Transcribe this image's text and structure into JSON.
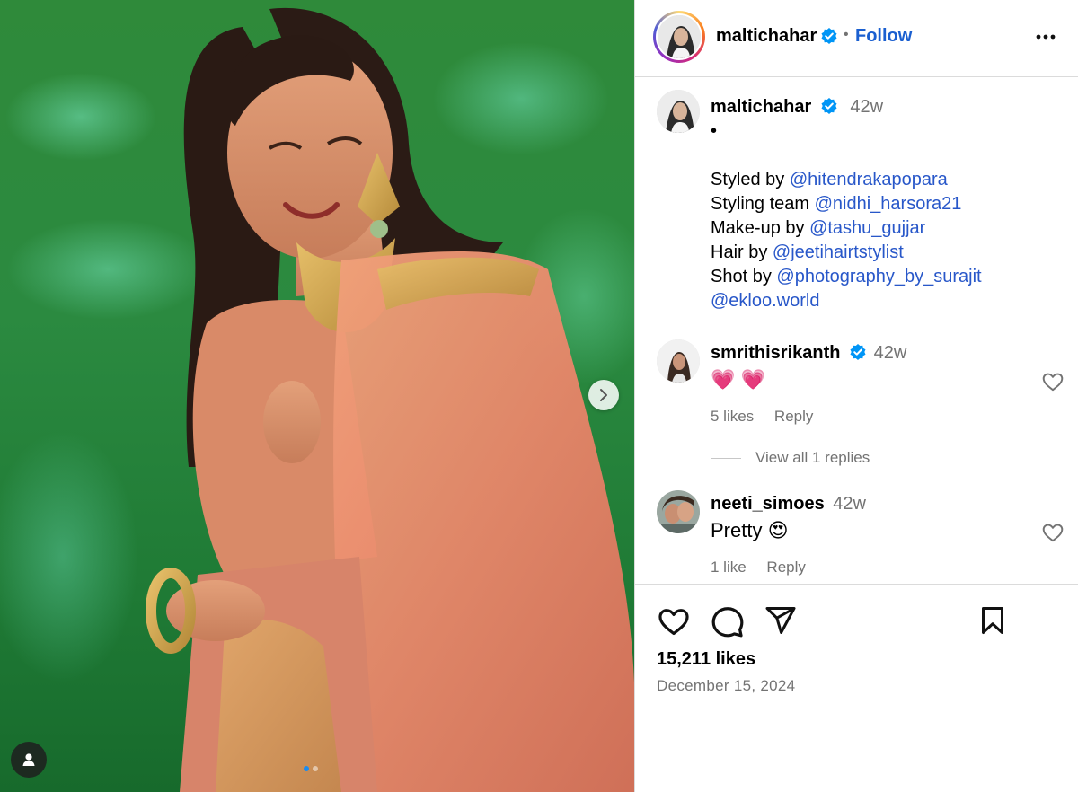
{
  "post": {
    "author": "maltichahar",
    "follow_label": "Follow",
    "separator": "•",
    "image": {
      "description_icon": "photo",
      "carousel_total": 2,
      "carousel_index": 1
    }
  },
  "caption": {
    "user": "maltichahar",
    "time": "42w",
    "bullet": "•",
    "lines": [
      {
        "prefix": "Styled by ",
        "mention": "@hitendrakapopara"
      },
      {
        "prefix": "Styling team ",
        "mention": "@nidhi_harsora21"
      },
      {
        "prefix": "Make-up by ",
        "mention": "@tashu_gujjar"
      },
      {
        "prefix": "Hair by ",
        "mention": "@jeetihairtstylist"
      },
      {
        "prefix": "Shot by ",
        "mention": "@photography_by_surajit"
      },
      {
        "prefix": "",
        "mention": "@ekloo.world"
      }
    ]
  },
  "comments": [
    {
      "user": "smrithisrikanth",
      "verified": true,
      "time": "42w",
      "text": "💗 💗",
      "likes": "5 likes",
      "reply": "Reply"
    },
    {
      "user": "neeti_simoes",
      "verified": false,
      "time": "42w",
      "text": "Pretty 😍",
      "likes": "1 like",
      "reply": "Reply"
    }
  ],
  "view_replies": "View all 1 replies",
  "footer": {
    "likes": "15,211 likes",
    "date": "December 15, 2024"
  },
  "colors": {
    "verified": "#0095f6",
    "follow": "#1a5fd0",
    "mention": "#2857c9",
    "muted": "#737373",
    "border": "#dbdbdb"
  },
  "icons": [
    "verified-badge-icon",
    "more-options-icon",
    "heart-icon",
    "comment-icon",
    "share-icon",
    "bookmark-icon",
    "chevron-right-icon",
    "user-tag-icon"
  ]
}
